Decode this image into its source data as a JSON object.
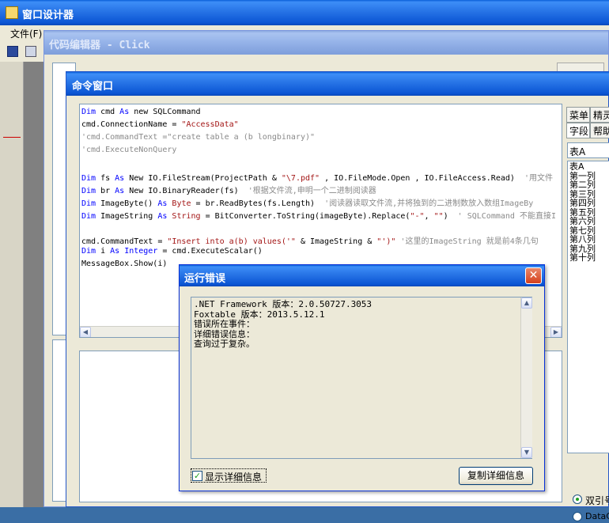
{
  "designer": {
    "title": "窗口设计器",
    "menu_file": "文件(F)"
  },
  "code_editor": {
    "title": "代码编辑器 - Click"
  },
  "command_window": {
    "title": "命令窗口",
    "tabs_row1": [
      "菜单",
      "精灵"
    ],
    "tabs_row2": [
      "字段",
      "帮助"
    ],
    "table_select": "表A",
    "fields": [
      "表A",
      "第一列",
      "第二列",
      "第三列",
      "第四列",
      "第五列",
      "第六列",
      "第七列",
      "第八列",
      "第九列",
      "第十列"
    ],
    "radio_quote": "双引号",
    "radio_datacol": "DataCol"
  },
  "error_dialog": {
    "title": "运行错误",
    "lines": [
      ".NET Framework 版本：2.0.50727.3053",
      "Foxtable 版本：2013.5.12.1",
      "错误所在事件：",
      "详细错误信息：",
      "查询过于复杂。"
    ],
    "show_details_label": "显示详细信息",
    "copy_button_label": "复制详细信息"
  },
  "colors": {
    "keyword": "#0000ff",
    "string": "#a31515",
    "comment": "#8a8a8a"
  }
}
